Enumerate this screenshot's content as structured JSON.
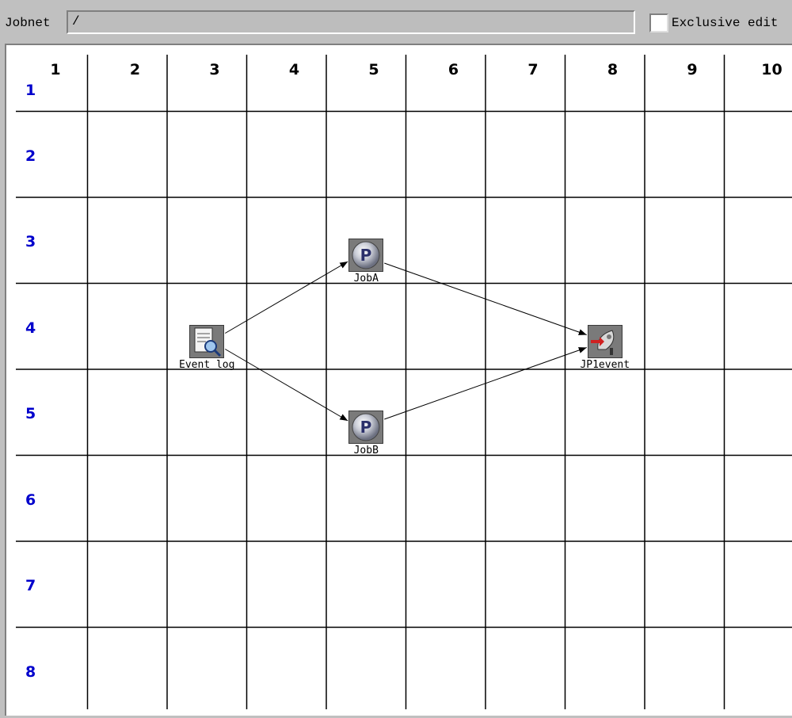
{
  "toolbar": {
    "jobnet_label": "Jobnet",
    "jobnet_value": "/",
    "exclusive_edit_label": "Exclusive edit",
    "exclusive_edit_checked": false
  },
  "map": {
    "columns": [
      "1",
      "2",
      "3",
      "4",
      "5",
      "6",
      "7",
      "8",
      "9",
      "10"
    ],
    "rows": [
      "1",
      "2",
      "3",
      "4",
      "5",
      "6",
      "7",
      "8"
    ],
    "jobs": [
      {
        "id": "eventlog",
        "label": "Event log",
        "icon": "event-log-icon",
        "column": 3,
        "row": 4
      },
      {
        "id": "joba",
        "label": "JobA",
        "icon": "pc-job-icon",
        "column": 5,
        "row": 3
      },
      {
        "id": "jobb",
        "label": "JobB",
        "icon": "pc-job-icon",
        "column": 5,
        "row": 5
      },
      {
        "id": "jp1event",
        "label": "JP1event",
        "icon": "jp1-event-send-icon",
        "column": 8,
        "row": 4
      }
    ],
    "relations": [
      {
        "from": "eventlog",
        "to": "joba"
      },
      {
        "from": "eventlog",
        "to": "jobb"
      },
      {
        "from": "joba",
        "to": "jp1event"
      },
      {
        "from": "jobb",
        "to": "jp1event"
      }
    ]
  },
  "colors": {
    "row_number": "#0000cc",
    "column_number": "#000000",
    "background": "#c0c0c0",
    "map_background": "#ffffff"
  }
}
